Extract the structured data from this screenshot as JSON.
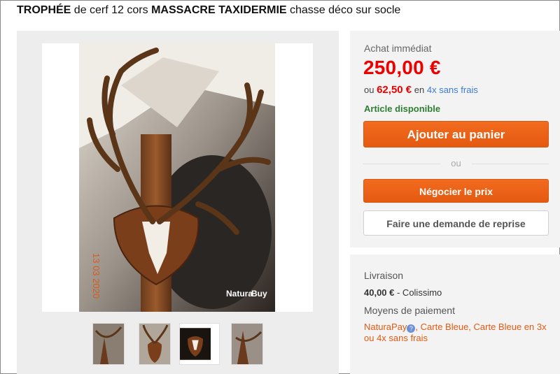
{
  "title": {
    "part1": "TROPHÉE",
    "part2": " de cerf 12 cors ",
    "part3": "MASSACRE TAXIDERMIE",
    "part4": " chasse déco sur socle"
  },
  "photo": {
    "date_stamp": "13 03 2020",
    "watermark_left": "Natura",
    "watermark_right": "Buy"
  },
  "thumbnails": [
    {
      "name": "thumbnail-1"
    },
    {
      "name": "thumbnail-2"
    },
    {
      "name": "thumbnail-3"
    },
    {
      "name": "thumbnail-4"
    }
  ],
  "buy_box": {
    "label": "Achat immédiat",
    "price": "250,00 €",
    "installment_prefix": "ou",
    "installment_price": "62,50 €",
    "installment_mid": "en",
    "installment_link": "4x sans frais",
    "availability": "Article disponible",
    "add_to_cart": "Ajouter au panier",
    "or_label": "ou",
    "negotiate": "Négocier le prix",
    "trade_in": "Faire une demande de reprise"
  },
  "shipping": {
    "label": "Livraison",
    "price": "40,00 €",
    "method": " - Colissimo",
    "payment_label": "Moyens de paiement",
    "payment_first": "NaturaPay",
    "payment_rest": ", Carte Bleue, Carte Bleue en 3x ou 4x sans frais"
  },
  "colors": {
    "accent_orange": "#e35a10",
    "price_red": "#ee0000",
    "available_green": "#2e7d32",
    "link_blue": "#3a7bd5"
  },
  "icons": [
    "help-icon"
  ]
}
